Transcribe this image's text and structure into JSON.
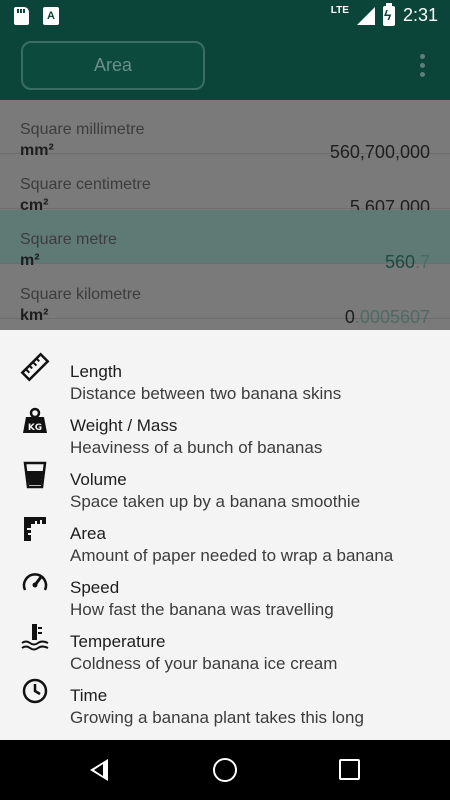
{
  "status_bar": {
    "network": "LTE",
    "time": "2:31",
    "notif_icons": [
      "sd-card-icon",
      "font-a-icon"
    ]
  },
  "toolbar": {
    "category_button": "Area",
    "menu_icon": "overflow-menu-icon"
  },
  "units": [
    {
      "name": "Square millimetre",
      "symbol": "mm²",
      "value": "560,700,000",
      "selected": false
    },
    {
      "name": "Square centimetre",
      "symbol": "cm²",
      "value": "5,607,000",
      "selected": false
    },
    {
      "name": "Square metre",
      "symbol": "m²",
      "value_main": "560",
      "value_dim": ".7",
      "selected": true
    },
    {
      "name": "Square kilometre",
      "symbol": "km²",
      "value_main": "0",
      "value_dim": ".0005607",
      "selected": false
    }
  ],
  "categories": [
    {
      "title": "Length",
      "desc": "Distance between two banana skins",
      "icon": "ruler-icon"
    },
    {
      "title": "Weight / Mass",
      "desc": "Heaviness of a bunch of bananas",
      "icon": "kg-weight-icon"
    },
    {
      "title": "Volume",
      "desc": "Space taken up by a banana smoothie",
      "icon": "cup-icon"
    },
    {
      "title": "Area",
      "desc": "Amount of paper needed to wrap a banana",
      "icon": "area-ruler-icon"
    },
    {
      "title": "Speed",
      "desc": "How fast the banana was travelling",
      "icon": "speedometer-icon"
    },
    {
      "title": "Temperature",
      "desc": "Coldness of your banana ice cream",
      "icon": "thermometer-icon"
    },
    {
      "title": "Time",
      "desc": "Growing a banana plant takes this long",
      "icon": "clock-icon"
    }
  ],
  "nav": [
    "back-icon",
    "home-icon",
    "recents-icon"
  ],
  "colors": {
    "primary_dark": "#0b4438",
    "scrim": "#7a7a7a",
    "sheet": "#f4f4f4"
  }
}
